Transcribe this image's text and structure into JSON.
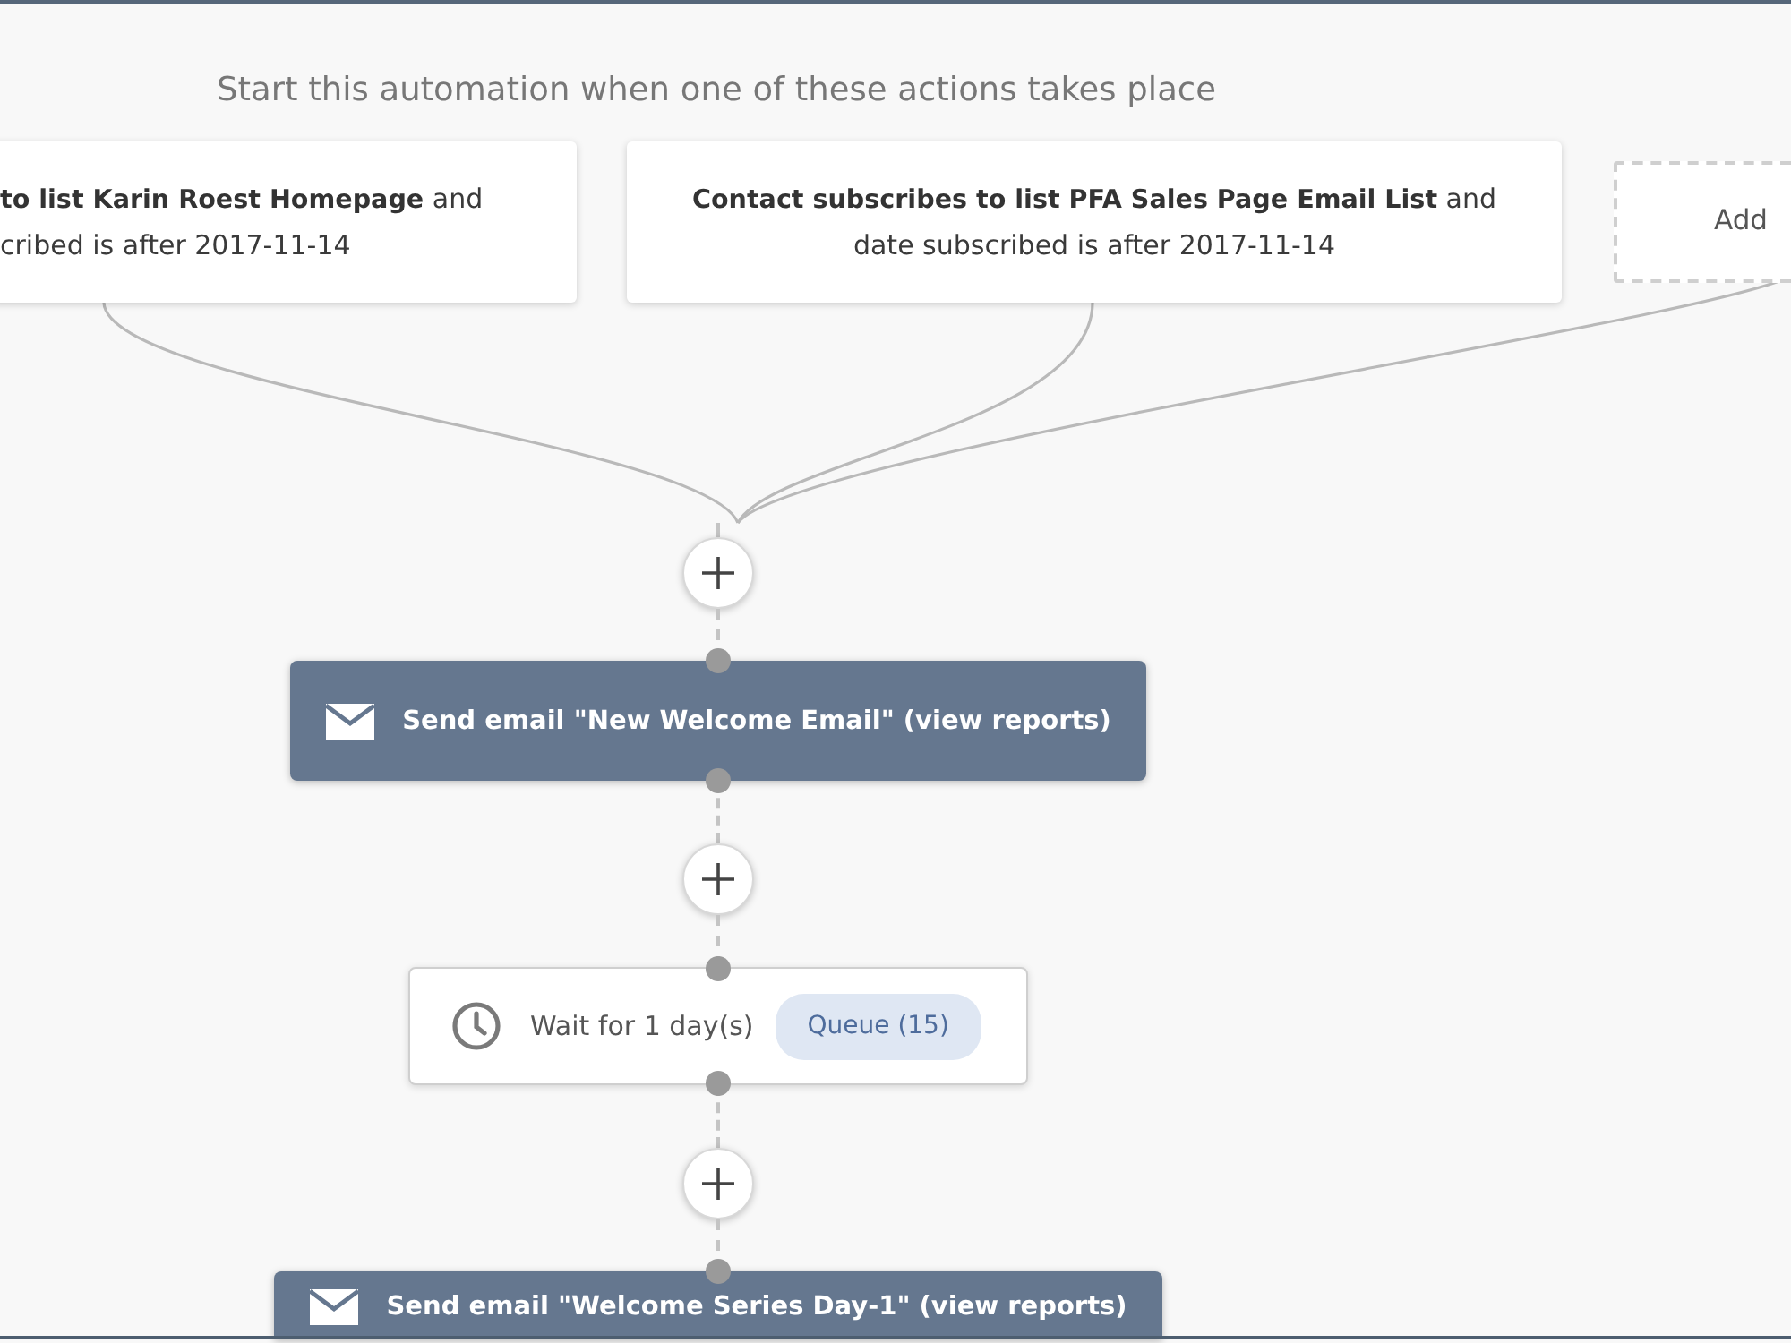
{
  "heading": "Start this automation when one of these actions takes place",
  "triggers": [
    {
      "kind": "trigger",
      "lines": [
        "**to list Karin Roest Homepage** and",
        "cribed is after 2017-11-14"
      ]
    },
    {
      "kind": "trigger",
      "lines": [
        "**Contact subscribes to list PFA Sales Page Email List** and",
        "date subscribed is after 2017-11-14"
      ]
    },
    {
      "kind": "add",
      "label": "Add"
    }
  ],
  "steps": [
    {
      "kind": "email",
      "text": "Send email \"New Welcome Email\"",
      "link": "(view reports)"
    },
    {
      "kind": "wait",
      "text": "Wait for 1 day(s)",
      "badge": "Queue (15)"
    },
    {
      "kind": "email",
      "text": "Send email \"Welcome Series Day-1\"",
      "link": "(view reports)"
    }
  ]
}
